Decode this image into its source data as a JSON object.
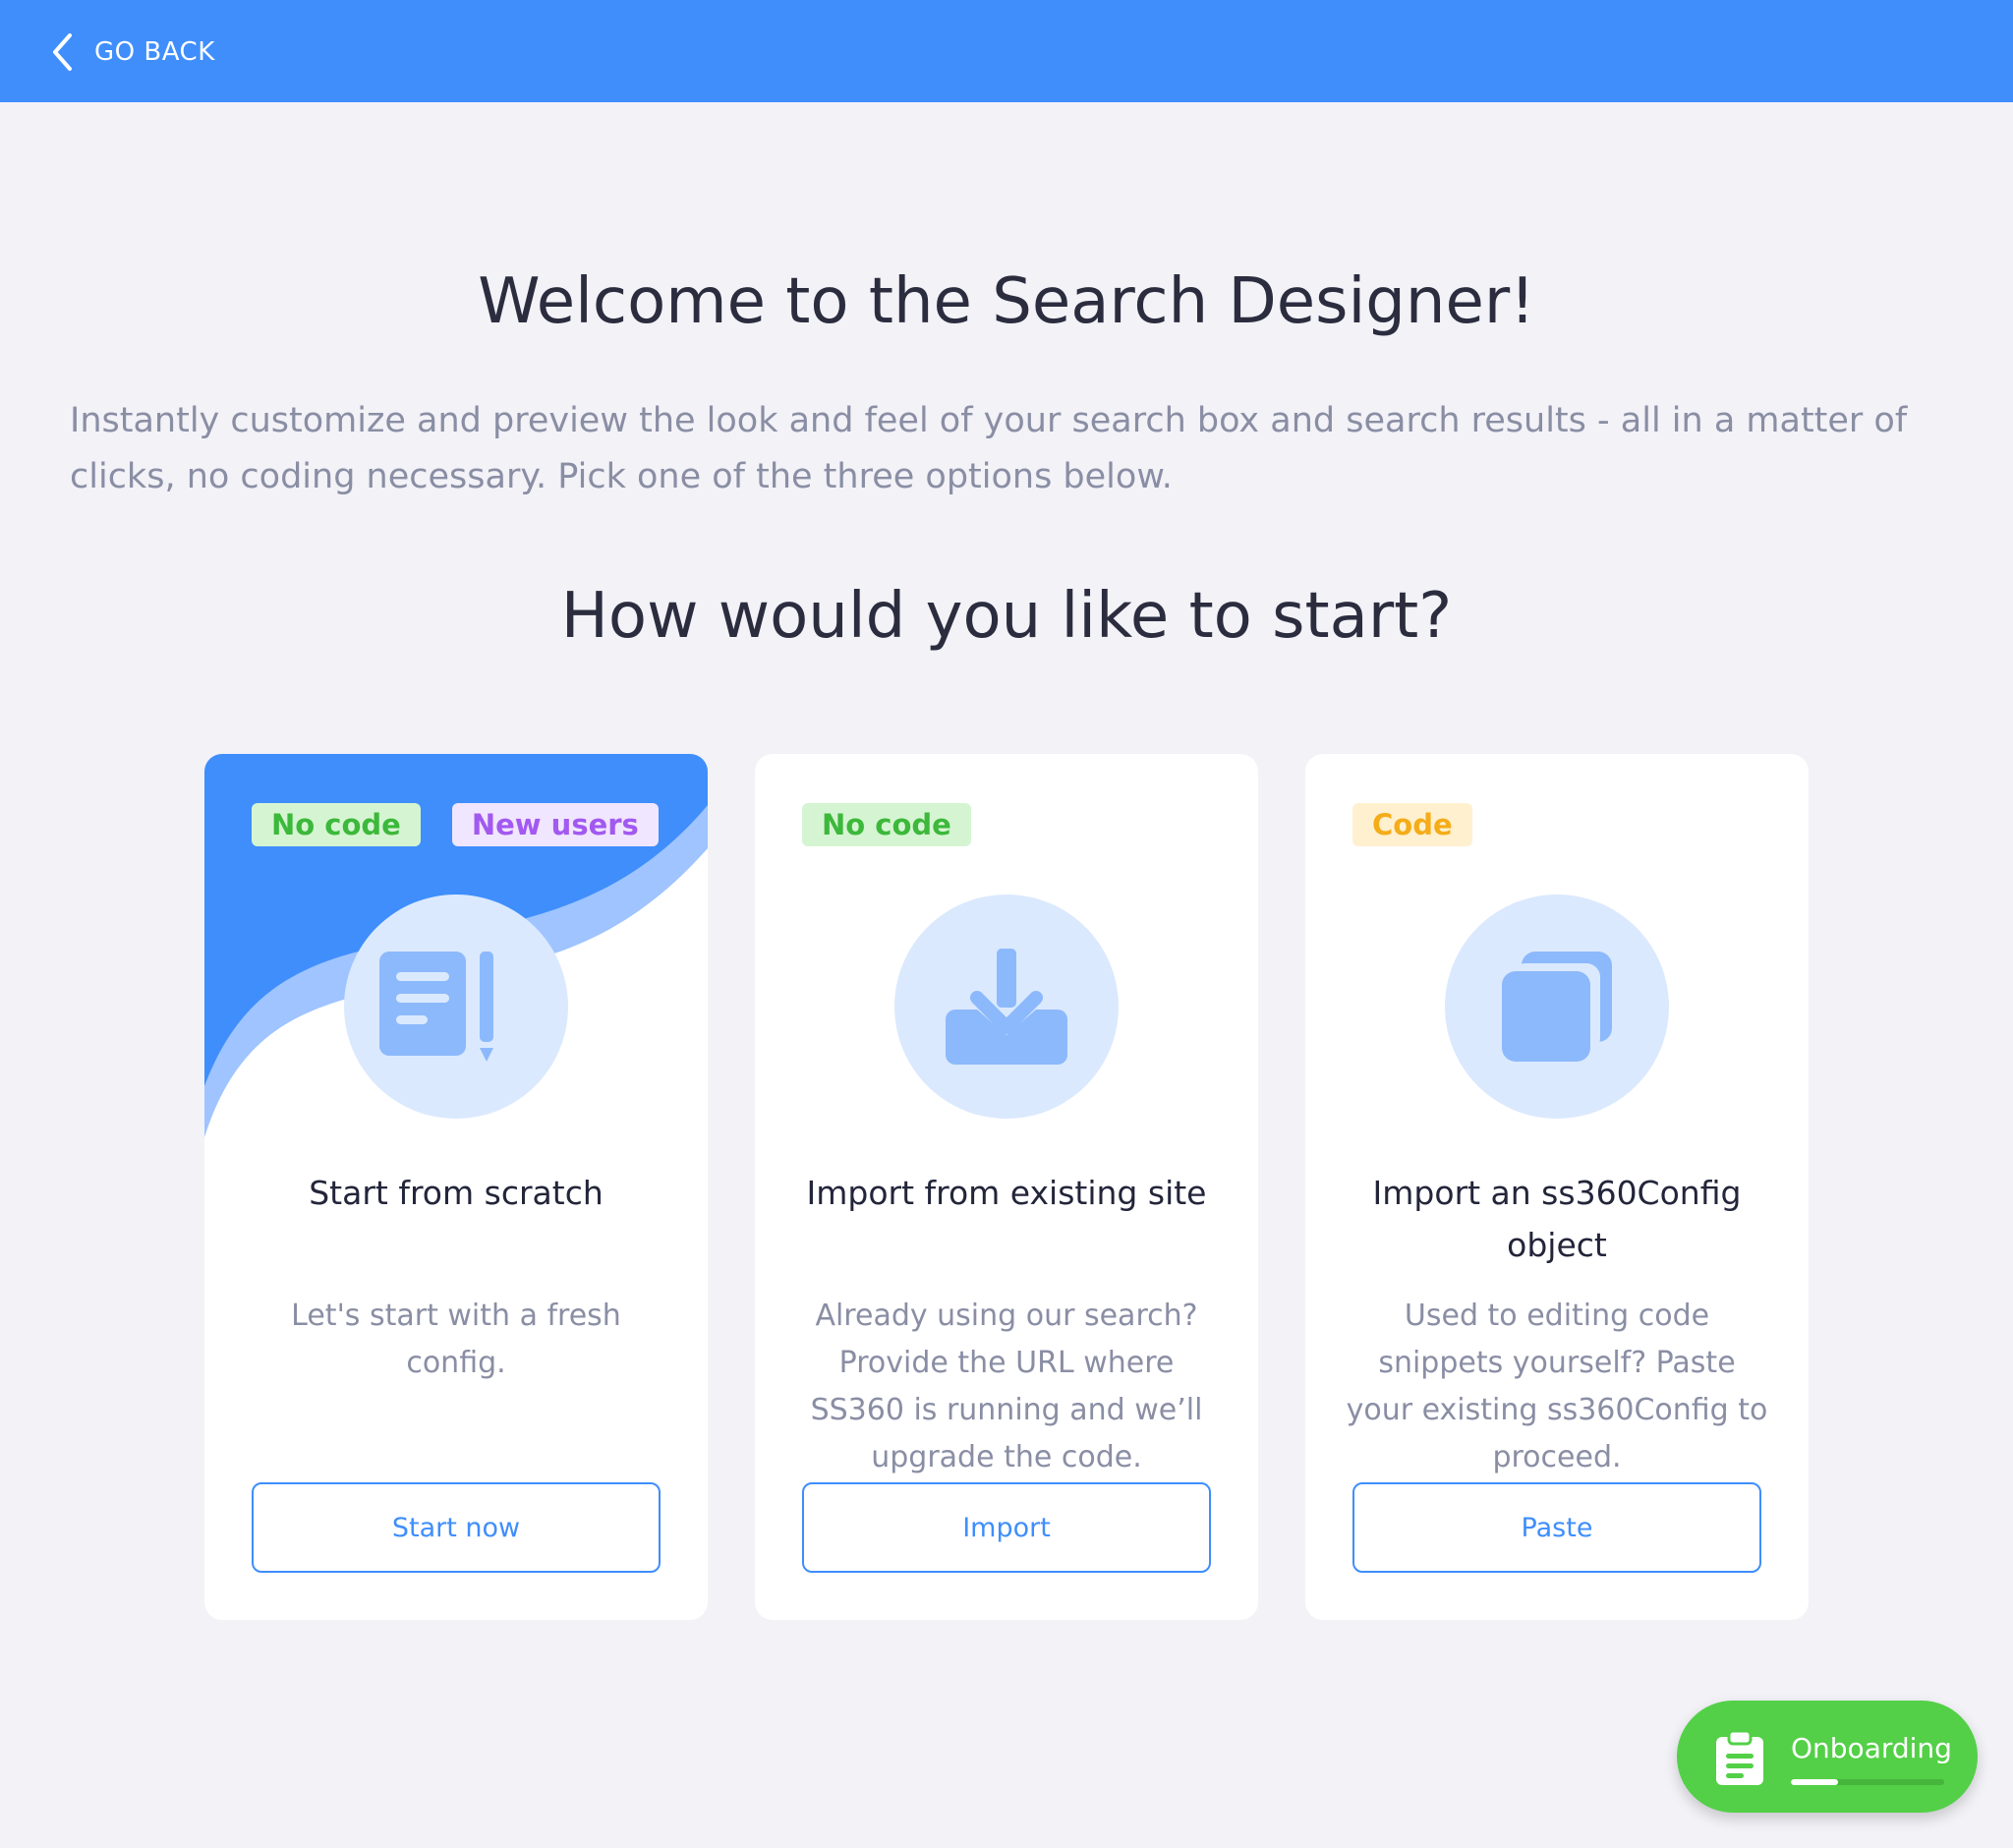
{
  "topbar": {
    "back_label": "GO BACK",
    "color": "#3f8efc"
  },
  "header": {
    "title": "Welcome to the Search Designer!",
    "intro": "Instantly customize and preview the look and feel of your search box and search results - all in a matter of clicks, no coding necessary. Pick one of the three options below.",
    "subtitle": "How would you like to start?"
  },
  "cards": [
    {
      "tags": [
        "No code",
        "New users"
      ],
      "icon": "document-edit-icon",
      "title": "Start from scratch",
      "description": "Let's start with a fresh config.",
      "button": "Start now",
      "selected": true
    },
    {
      "tags": [
        "No code"
      ],
      "icon": "download-icon",
      "title": "Import from existing site",
      "description": "Already using our search? Provide the URL where SS360 is running and we’ll upgrade the code.",
      "button": "Import",
      "selected": false
    },
    {
      "tags": [
        "Code"
      ],
      "icon": "copy-icon",
      "title": "Import an ss360Config object",
      "description": "Used to editing code snippets yourself? Paste your existing ss360Config to proceed.",
      "button": "Paste",
      "selected": false
    }
  ],
  "onboarding": {
    "label": "Onboarding",
    "progress": 0.31,
    "icon": "clipboard-icon",
    "color": "#53d047"
  },
  "colors": {
    "accent": "#3f8efc",
    "tag_green": "#3cb83a",
    "tag_purple": "#a259f0",
    "tag_yellow": "#f4ac19"
  }
}
